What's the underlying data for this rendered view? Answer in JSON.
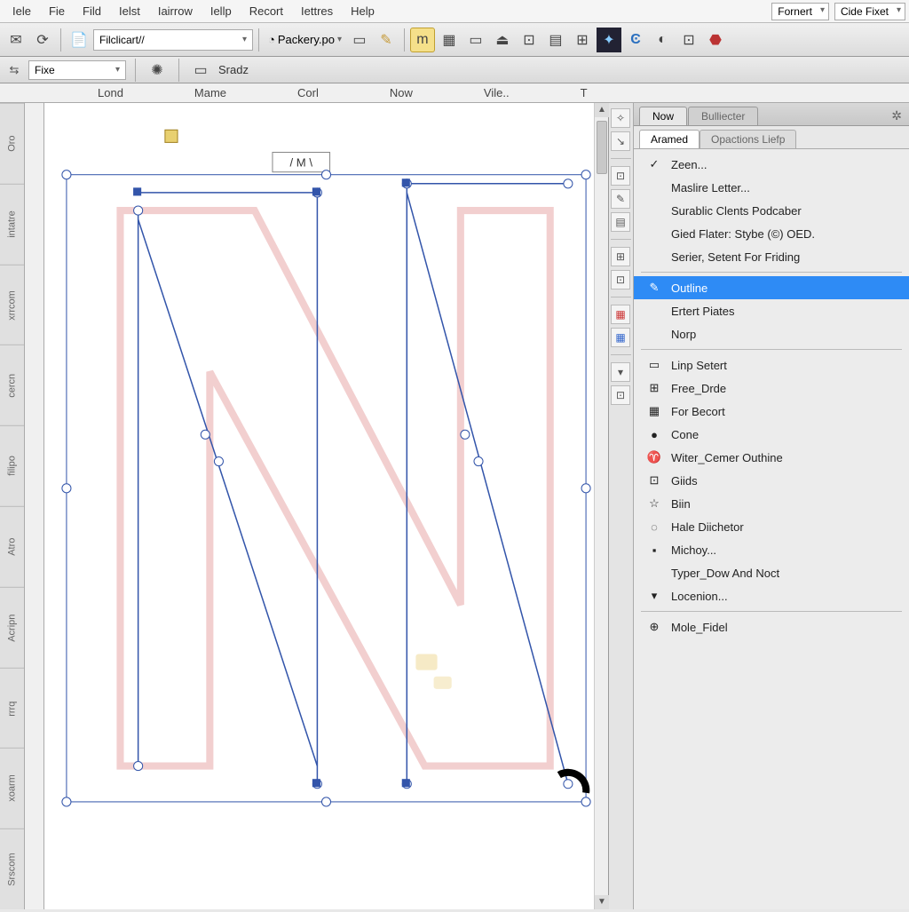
{
  "menu": {
    "items": [
      "Iele",
      "Fie",
      "Fild",
      "Ielst",
      "Iairrow",
      "Iellp",
      "Recort",
      "Iettres",
      "Help"
    ],
    "right_combo1": "Fornert",
    "right_combo2": "Cide Fixet"
  },
  "toolbar": {
    "address": "Filclicart//",
    "packery": "Packery.po"
  },
  "secondbar": {
    "combo_label": "Fixe",
    "right_label": "Sradz"
  },
  "ruler": {
    "cols": [
      "Lond",
      "Mame",
      "Corl",
      "Now",
      "Vile..",
      "T"
    ]
  },
  "canvas": {
    "label": "/ M \\"
  },
  "left_tabs": [
    "Oro",
    "intatre",
    "xrrcom",
    "cercn",
    "filipo",
    "Atro",
    "Acripn",
    "rrrq",
    "xoarm",
    "Srscom"
  ],
  "right_panel": {
    "top_tabs": [
      "Now",
      "Bulliecter"
    ],
    "sub_tabs": [
      "Aramed",
      "Opactions Liefp"
    ],
    "group1": [
      {
        "icon": "✓",
        "label": "Zeen..."
      },
      {
        "icon": "",
        "label": "Maslire Letter..."
      },
      {
        "icon": "",
        "label": "Surablic Clents Podcaber"
      },
      {
        "icon": "",
        "label": "Gied Flater: Stybe (©) OED."
      },
      {
        "icon": "",
        "label": "Serier, Setent For Friding"
      }
    ],
    "group2": [
      {
        "icon": "✎",
        "label": "Outline",
        "selected": true
      },
      {
        "icon": "",
        "label": "Ertert Piates"
      },
      {
        "icon": "",
        "label": "Norp"
      }
    ],
    "group3": [
      {
        "icon": "▭",
        "label": "Linp Setert"
      },
      {
        "icon": "⊞",
        "label": "Free_Drde"
      },
      {
        "icon": "▦",
        "label": "For Becort"
      },
      {
        "icon": "●",
        "label": "Cone"
      },
      {
        "icon": "♈",
        "label": "Witer_Cemer Outhine"
      },
      {
        "icon": "⊡",
        "label": "Giids"
      },
      {
        "icon": "☆",
        "label": "Biin"
      },
      {
        "icon": "◌",
        "label": "Hale Diichetor"
      },
      {
        "icon": "▪",
        "label": "Michoy..."
      },
      {
        "icon": "",
        "label": "Typer_Dow And Noct"
      },
      {
        "icon": "▾",
        "label": "Locenion..."
      }
    ],
    "group4": [
      {
        "icon": "⊕",
        "label": "Mole_Fidel"
      }
    ]
  }
}
